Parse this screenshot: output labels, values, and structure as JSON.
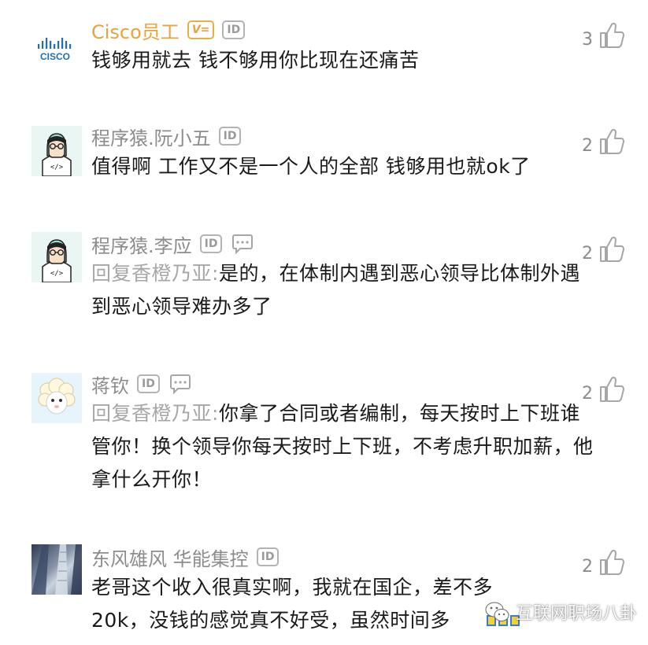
{
  "colors": {
    "username": "#8c8c8c",
    "vip_username": "#e8a33a",
    "reply_prefix": "#a6a6a6",
    "comment_text": "#1a1a1a",
    "badge_border": "#b3b3b3"
  },
  "comments": [
    {
      "username": "Cisco员工",
      "vip_badge": "V=",
      "id_badge": "ID",
      "avatar": "cisco-logo",
      "avatar_text": "CISCO",
      "likes": "3",
      "text": "钱够用就去 钱不够用你比现在还痛苦"
    },
    {
      "username": "程序猿.阮小五",
      "id_badge": "ID",
      "avatar": "programmer-avatar",
      "likes": "2",
      "text": "值得啊 工作又不是一个人的全部 钱够用也就ok了"
    },
    {
      "username": "程序猿.李应",
      "id_badge": "ID",
      "has_chat_icon": true,
      "avatar": "programmer-avatar",
      "likes": "2",
      "reply_prefix": "回复香橙乃亚:",
      "text": "是的，在体制内遇到恶心领导比体制外遇到恶心领导难办多了"
    },
    {
      "username": "蒋钦",
      "id_badge": "ID",
      "has_chat_icon": true,
      "avatar": "sheep-avatar",
      "likes": "2",
      "reply_prefix": "回复香橙乃亚:",
      "text": "你拿了合同或者编制，每天按时上下班谁管你！换个领导你每天按时上下班，不考虑升职加薪，他拿什么开你！"
    },
    {
      "username": "东风雄风 华能集控",
      "id_badge": "ID",
      "avatar": "building-photo",
      "likes": "2",
      "text": "老哥这个收入很真实啊，我就在国企，差不多20k，没钱的感觉真不好受，虽然时间多"
    }
  ],
  "watermark": {
    "text": "互联网职场八卦",
    "icon": "wechat-icon"
  }
}
